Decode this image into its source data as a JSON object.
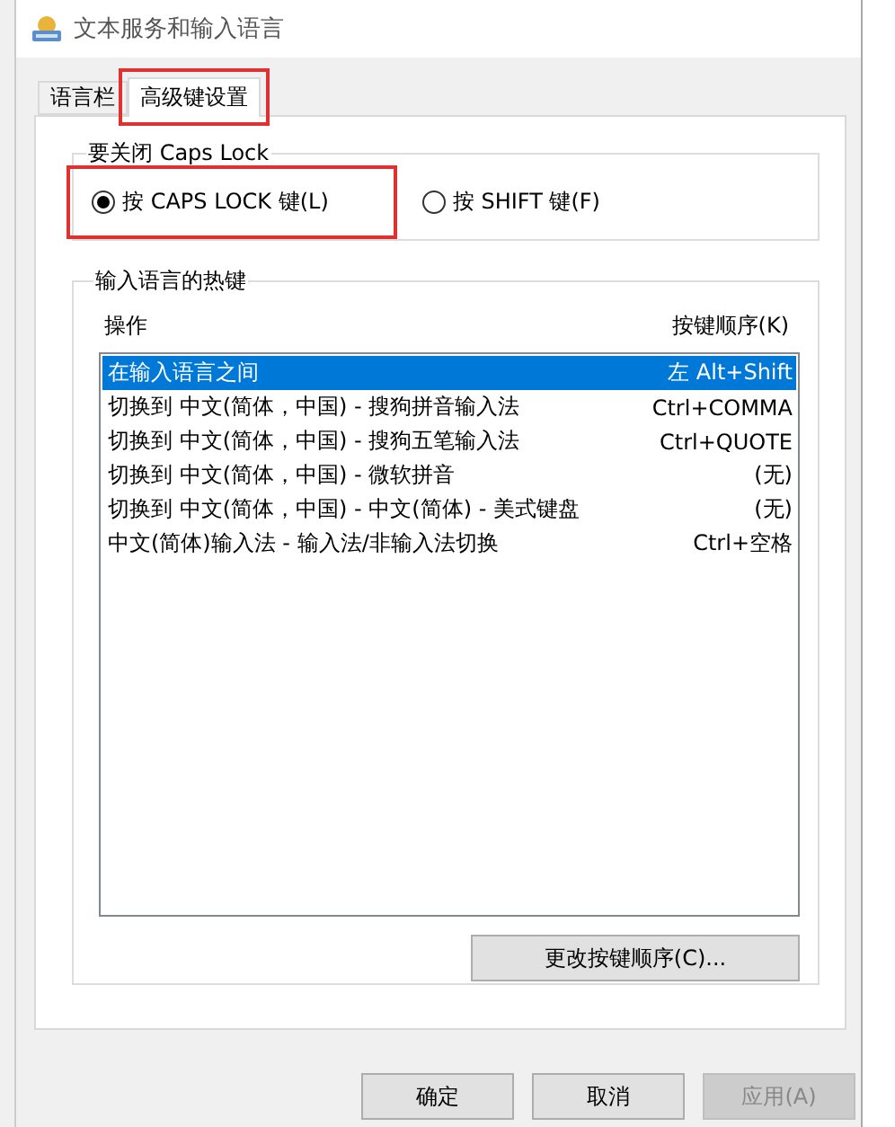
{
  "window": {
    "title": "文本服务和输入语言"
  },
  "tabs": [
    {
      "label": "语言栏",
      "selected": false,
      "highlighted": false
    },
    {
      "label": "高级键设置",
      "selected": true,
      "highlighted": true
    }
  ],
  "caps_lock": {
    "title": "要关闭 Caps Lock",
    "options": [
      {
        "label": "按 CAPS LOCK 键(L)",
        "selected": true,
        "highlighted": true
      },
      {
        "label": "按 SHIFT 键(F)",
        "selected": false,
        "highlighted": false
      }
    ]
  },
  "hotkeys": {
    "title": "输入语言的热键",
    "columns": [
      "操作",
      "按键顺序(K)"
    ],
    "rows": [
      {
        "action": "在输入语言之间",
        "keys": "左 Alt+Shift",
        "selected": true
      },
      {
        "action": "切换到 中文(简体，中国) - 搜狗拼音输入法",
        "keys": "Ctrl+COMMA",
        "selected": false
      },
      {
        "action": "切换到 中文(简体，中国) - 搜狗五笔输入法",
        "keys": "Ctrl+QUOTE",
        "selected": false
      },
      {
        "action": "切换到 中文(简体，中国) - 微软拼音",
        "keys": "(无)",
        "selected": false
      },
      {
        "action": "切换到 中文(简体，中国) - 中文(简体) - 美式键盘",
        "keys": "(无)",
        "selected": false
      },
      {
        "action": "中文(简体)输入法 - 输入法/非输入法切换",
        "keys": "Ctrl+空格",
        "selected": false
      }
    ],
    "change_button": "更改按键顺序(C)..."
  },
  "buttons": [
    {
      "label": "确定",
      "disabled": false
    },
    {
      "label": "取消",
      "disabled": false
    },
    {
      "label": "应用(A)",
      "disabled": true
    }
  ]
}
